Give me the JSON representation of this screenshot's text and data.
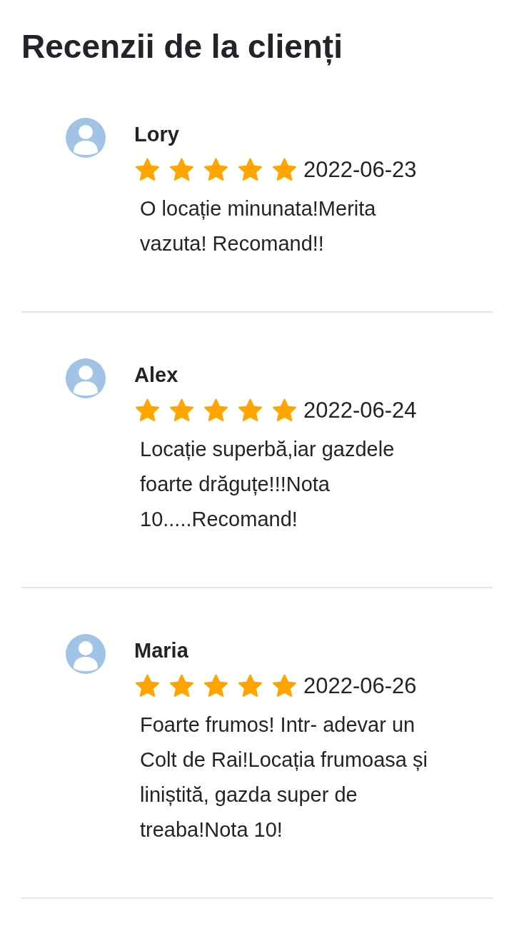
{
  "title": "Recenzii de la clienți",
  "reviews": [
    {
      "name": "Lory",
      "stars": 5,
      "date": "2022-06-23",
      "comment": "O locație minunata!Merita vazuta! Recomand!!"
    },
    {
      "name": "Alex",
      "stars": 5,
      "date": "2022-06-24",
      "comment": "Locație superbă,iar gazdele foarte drăguțe!!!Nota 10.....Recomand!"
    },
    {
      "name": "Maria",
      "stars": 5,
      "date": "2022-06-26",
      "comment": "Foarte frumos! Intr- adevar un Colt de Rai!Locația frumoasa și liniștită, gazda super de treaba!Nota 10!"
    }
  ]
}
